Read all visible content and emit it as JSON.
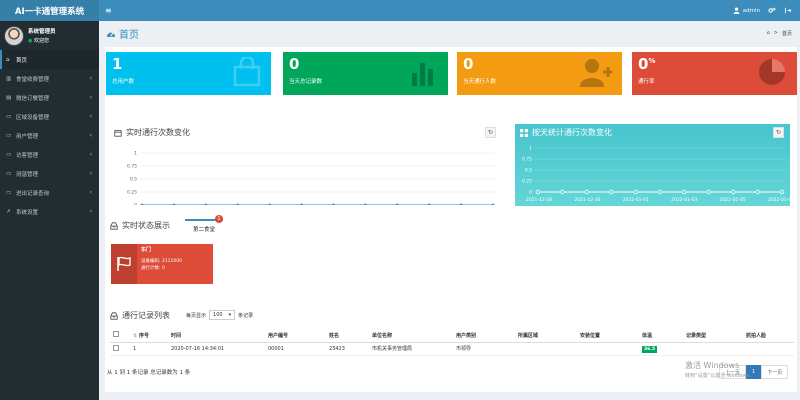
{
  "app": {
    "title": "AI一卡通管理系统"
  },
  "topbar": {
    "menu_toggle": "≡",
    "user": "admin"
  },
  "sidebar": {
    "user_name": "系统管理员",
    "user_status": "欢迎您",
    "items": [
      {
        "label": "首页",
        "active": true,
        "icon": "home-icon"
      },
      {
        "label": "食堂收费管理",
        "icon": "bank-icon"
      },
      {
        "label": "微信订餐管理",
        "icon": "book-icon"
      },
      {
        "label": "区域设备管理",
        "icon": "desktop-icon"
      },
      {
        "label": "用户管理",
        "icon": "desktop-icon"
      },
      {
        "label": "访客管理",
        "icon": "desktop-icon"
      },
      {
        "label": "测温管理",
        "icon": "desktop-icon"
      },
      {
        "label": "进出记录查询",
        "icon": "desktop-icon"
      },
      {
        "label": "系统设置",
        "icon": "chart-icon"
      }
    ]
  },
  "header": {
    "title": "首页",
    "breadcrumb": "首页"
  },
  "stats": [
    {
      "value": "1",
      "label": "总用户数",
      "color": "#00c0ef",
      "icon": "bag-icon"
    },
    {
      "value": "0",
      "label": "当天总记录数",
      "color": "#00a65a",
      "icon": "bar-chart-icon"
    },
    {
      "value": "0",
      "label": "当天通行人数",
      "color": "#f39c12",
      "icon": "user-add-icon"
    },
    {
      "value": "0",
      "unit": "%",
      "label": "通行率",
      "color": "#dd4b39",
      "icon": "pie-chart-icon"
    }
  ],
  "charts": {
    "realtime": {
      "title": "实时通行次数变化",
      "chart_data": {
        "type": "line",
        "x": [
          "03:00",
          "04:00",
          "05:00",
          "06:00",
          "07:00",
          "08:00",
          "09:00",
          "10:00",
          "11:00",
          "12:00",
          "13:00",
          "14:00"
        ],
        "yticks": [
          "1",
          "0.75",
          "0.5",
          "0.25",
          "0"
        ],
        "ylim": [
          0,
          1
        ],
        "series": [
          {
            "values": [
              0,
              0,
              0,
              0,
              0,
              0,
              0,
              0,
              0,
              0,
              0,
              0
            ]
          }
        ],
        "color": "#3c8dbc"
      }
    },
    "daily": {
      "title": "按天统计通行次数变化",
      "chart_data": {
        "type": "line",
        "x": [
          "2021-12-28",
          "2021-12-30",
          "2022-01-01",
          "2022-01-03",
          "2022-01-05",
          "2022-01-07"
        ],
        "yticks": [
          "1",
          "0.75",
          "0.5",
          "0.25",
          "0"
        ],
        "ylim": [
          0,
          1
        ],
        "series": [
          {
            "values": [
              0,
              0,
              0,
              0,
              0,
              0,
              0,
              0,
              0,
              0,
              0
            ]
          }
        ],
        "color": "#ffffff"
      }
    }
  },
  "realtime_status": {
    "title": "实时状态展示",
    "tab": "第二食堂",
    "tab_badge": "1",
    "card": {
      "title": "东门",
      "line1": "设备编码: 2111000",
      "line2": "通行计数: 0",
      "color": "#dd4b39"
    }
  },
  "records": {
    "title": "通行记录列表",
    "per_page_label": "每页显示",
    "per_page_value": "100",
    "per_page_suffix": "条记录",
    "columns": [
      "序号",
      "时间",
      "用户编号",
      "姓名",
      "单位名称",
      "用户类别",
      "所属区域",
      "安装位置",
      "体温",
      "记录类型",
      "抓拍人脸"
    ],
    "rows": [
      {
        "no": "1",
        "time": "2020-07-16 14:34:01",
        "user_no": "00001",
        "name": "23423",
        "unit": "市机关事务管理局",
        "category": "市领导",
        "region": "",
        "location": "",
        "temp": "36.5",
        "type": "",
        "face": ""
      }
    ],
    "summary": "从 1 到 1 条记录 总记录数为 1 条",
    "pager": {
      "prev": "上一页",
      "page": "1",
      "next": "下一页"
    }
  },
  "watermark": {
    "line1": "激活 Windows",
    "line2": "转到“设置”以激活 Windows。"
  }
}
